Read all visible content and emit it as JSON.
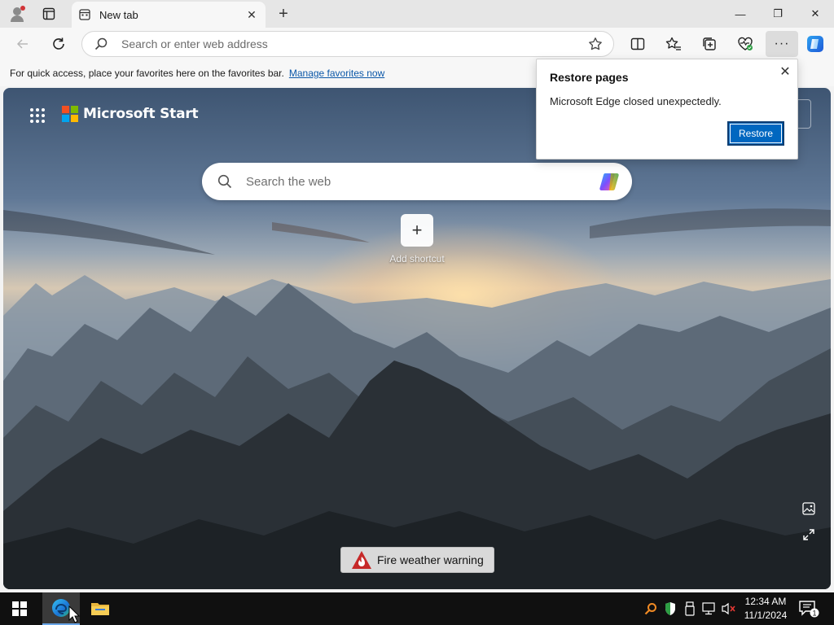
{
  "tab": {
    "title": "New tab",
    "close_label": "✕"
  },
  "new_tab_label": "+",
  "window_controls": {
    "minimize": "—",
    "maximize": "❐",
    "close": "✕"
  },
  "addressbar": {
    "placeholder": "Search or enter web address",
    "value": ""
  },
  "more_label": "···",
  "favorites_bar": {
    "message": "For quick access, place your favorites here on the favorites bar.",
    "link": "Manage favorites now"
  },
  "ntp": {
    "brand": "Microsoft Start",
    "search_placeholder": "Search the web",
    "add_shortcut_icon": "+",
    "add_shortcut_label": "Add shortcut",
    "fire_warning": "Fire weather warning"
  },
  "restore_popup": {
    "title": "Restore pages",
    "message": "Microsoft Edge closed unexpectedly.",
    "button": "Restore",
    "close_label": "✕"
  },
  "taskbar": {
    "time": "12:34 AM",
    "date": "11/1/2024",
    "notification_count": "1"
  },
  "colors": {
    "accent": "#0067c0",
    "link": "#0b57a8",
    "taskbar": "#101010",
    "ms_red": "#f25022",
    "ms_green": "#7fba00",
    "ms_blue": "#00a4ef",
    "ms_yellow": "#ffb900"
  },
  "icons": [
    "profile-icon",
    "tab-actions-icon",
    "newtab-page-icon",
    "back-icon",
    "refresh-icon",
    "search-icon",
    "star-icon",
    "split-screen-icon",
    "favorites-icon",
    "collections-icon",
    "browser-essentials-icon",
    "more-icon",
    "copilot-icon",
    "apps-grid-icon",
    "microsoft-logo",
    "image-info-icon",
    "expand-icon",
    "fire-icon",
    "windows-start-icon",
    "edge-icon",
    "file-explorer-icon",
    "notification-icon"
  ]
}
